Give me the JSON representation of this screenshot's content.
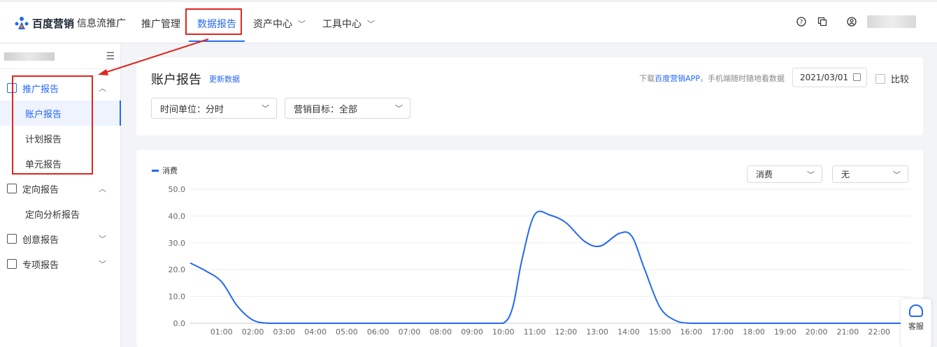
{
  "header": {
    "logo_text": "百度营销",
    "logo_sub": "信息流推广",
    "nav": [
      {
        "label": "推广管理",
        "chevron": false
      },
      {
        "label": "数据报告",
        "chevron": false,
        "active": true
      },
      {
        "label": "资产中心",
        "chevron": true
      },
      {
        "label": "工具中心",
        "chevron": true
      }
    ],
    "icons": [
      "help-icon",
      "copy-icon",
      "user-icon"
    ]
  },
  "sidebar": {
    "groups": [
      {
        "label": "推广报告",
        "active": true,
        "expanded": true,
        "icon": "report-icon",
        "items": [
          {
            "label": "账户报告",
            "active": true
          },
          {
            "label": "计划报告"
          },
          {
            "label": "单元报告"
          }
        ]
      },
      {
        "label": "定向报告",
        "expanded": true,
        "icon": "target-icon",
        "items": [
          {
            "label": "定向分析报告"
          }
        ]
      },
      {
        "label": "创意报告",
        "expanded": false,
        "icon": "creative-icon",
        "items": []
      },
      {
        "label": "专项报告",
        "expanded": false,
        "icon": "special-icon",
        "items": []
      }
    ]
  },
  "report": {
    "title": "账户报告",
    "refresh": "更新数据",
    "app_note_prefix": "下载",
    "app_note_link": "百度营销APP",
    "app_note_suffix": "，手机端随时随地看数据",
    "date": "2021/03/01",
    "compare_label": "比较",
    "time_unit": "时间单位：分时",
    "goal": "营销目标：全部"
  },
  "chart_controls": {
    "metric": "消费",
    "compare_metric": "无"
  },
  "float": {
    "service_label": "客服"
  },
  "colors": {
    "accent": "#2468f2",
    "annotation": "#e0251f"
  },
  "chart_data": {
    "type": "line",
    "series": [
      {
        "name": "消费",
        "values": [
          22.5,
          19.5,
          15.5,
          6.5,
          1.2,
          0,
          0,
          0,
          0,
          0,
          0,
          0,
          0,
          0,
          0,
          0,
          0,
          0,
          0,
          0,
          0,
          6,
          24,
          40.5,
          40.3,
          37.5,
          30.5,
          28.8,
          33.5,
          32.5,
          20.5,
          6,
          1,
          0,
          0,
          0,
          0,
          0,
          0,
          0,
          0,
          0,
          0,
          0,
          0,
          0,
          0,
          0
        ]
      }
    ],
    "x": [
      0,
      0.5,
      1,
      1.5,
      2,
      2.5,
      3,
      3.5,
      4,
      4.5,
      5,
      5.5,
      6,
      6.5,
      7,
      7.5,
      8,
      8.5,
      9,
      9.5,
      10,
      10.3,
      10.6,
      11,
      11.5,
      12,
      12.6,
      13.1,
      13.7,
      14.1,
      14.5,
      15,
      15.5,
      16,
      16.5,
      17,
      17.5,
      18,
      18.5,
      19,
      19.5,
      20,
      20.5,
      21,
      21.5,
      22,
      22.5,
      23
    ],
    "xticks": [
      "01:00",
      "02:00",
      "03:00",
      "04:00",
      "05:00",
      "06:00",
      "07:00",
      "08:00",
      "09:00",
      "10:00",
      "11:00",
      "12:00",
      "13:00",
      "14:00",
      "15:00",
      "16:00",
      "17:00",
      "18:00",
      "19:00",
      "20:00",
      "21:00",
      "22:00"
    ],
    "yticks": [
      "0.0",
      "10.0",
      "20.0",
      "30.0",
      "40.0",
      "50.0"
    ],
    "ylim": [
      0,
      50
    ],
    "xlim": [
      0,
      23
    ],
    "grid": true,
    "legend": "top-left"
  }
}
